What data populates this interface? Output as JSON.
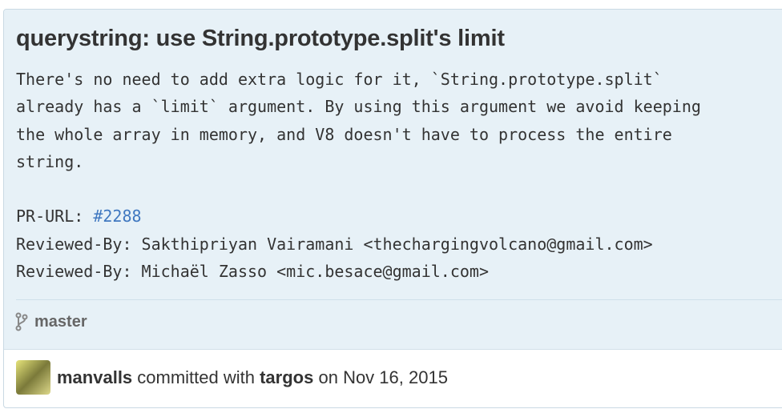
{
  "commit": {
    "title": "querystring: use String.prototype.split's limit",
    "body_lines": [
      "There's no need to add extra logic for it, `String.prototype.split`",
      "already has a `limit` argument. By using this argument we avoid keeping",
      "the whole array in memory, and V8 doesn't have to process the entire",
      "string."
    ],
    "pr_label": "PR-URL: ",
    "pr_link": "#2288",
    "reviewed": [
      "Reviewed-By: Sakthipriyan Vairamani <thechargingvolcano@gmail.com>",
      "Reviewed-By: Michaël Zasso <mic.besace@gmail.com>"
    ],
    "branch": "master",
    "author": "manvalls",
    "committed_with": " committed with ",
    "committer": "targos",
    "date_prefix": " on ",
    "date": "Nov 16, 2015"
  },
  "icons": {
    "branch": "git-branch-icon"
  }
}
